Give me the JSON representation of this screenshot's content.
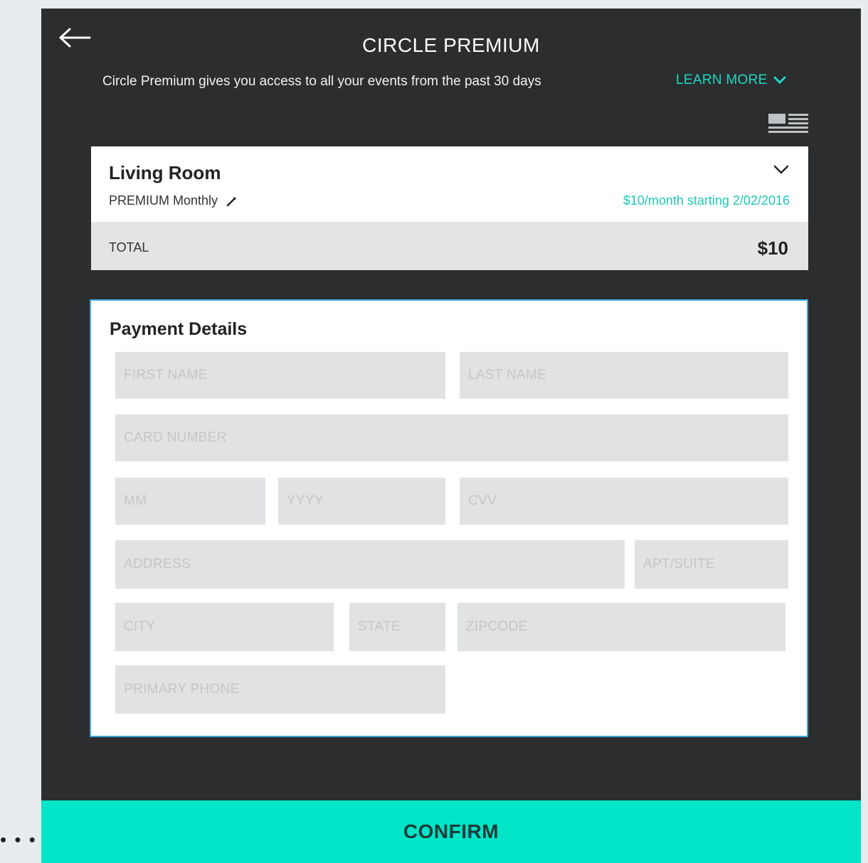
{
  "header": {
    "title": "CIRCLE PREMIUM",
    "subtitle": "Circle Premium gives you access to all your events from the past 30 days",
    "learn_more_label": "LEARN MORE",
    "back_icon": "arrow-left-icon",
    "list_icon": "list-icon"
  },
  "plan": {
    "name": "Living Room",
    "type": "PREMIUM Monthly",
    "price_text": "$10/month starting 2/02/2016",
    "total_label": "TOTAL",
    "total_value": "$10"
  },
  "payment": {
    "title": "Payment Details",
    "placeholders": {
      "first_name": "FIRST NAME",
      "last_name": "LAST NAME",
      "card_number": "CARD NUMBER",
      "mm": "MM",
      "yyyy": "YYYY",
      "cvv": "CVV",
      "address": "ADDRESS",
      "apt_suite": "APT/SUITE",
      "city": "CITY",
      "state": "STATE",
      "zipcode": "ZIPCODE",
      "primary_phone": "PRIMARY PHONE"
    }
  },
  "footer": {
    "confirm_label": "CONFIRM",
    "side_dots": "• • •"
  },
  "colors": {
    "accent": "#1fd9c3",
    "confirm_bg": "#00e5c8",
    "dark_bg": "#2b2d2e",
    "field_bg": "#e1e2e3",
    "card_border": "#3ea7d8"
  }
}
